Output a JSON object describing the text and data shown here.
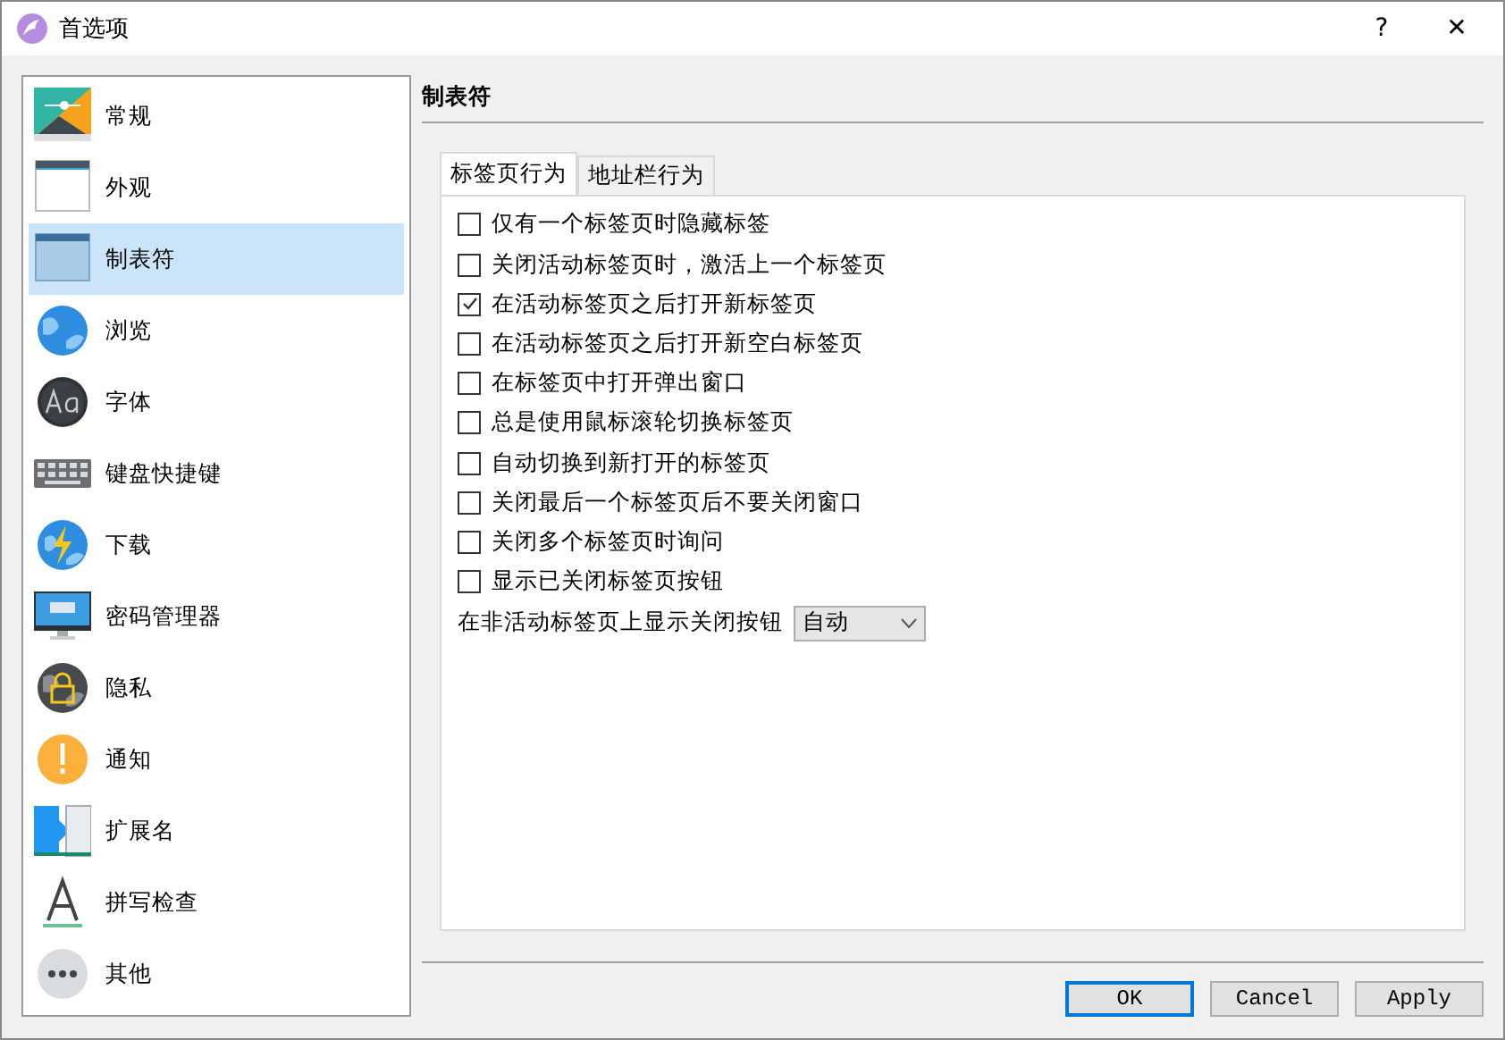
{
  "window": {
    "title": "首选项",
    "help": "?",
    "close": "✕"
  },
  "sidebar": {
    "items": [
      {
        "label": "常规",
        "selected": false
      },
      {
        "label": "外观",
        "selected": false
      },
      {
        "label": "制表符",
        "selected": true
      },
      {
        "label": "浏览",
        "selected": false
      },
      {
        "label": "字体",
        "selected": false
      },
      {
        "label": "键盘快捷键",
        "selected": false
      },
      {
        "label": "下载",
        "selected": false
      },
      {
        "label": "密码管理器",
        "selected": false
      },
      {
        "label": "隐私",
        "selected": false
      },
      {
        "label": "通知",
        "selected": false
      },
      {
        "label": "扩展名",
        "selected": false
      },
      {
        "label": "拼写检查",
        "selected": false
      },
      {
        "label": "其他",
        "selected": false
      }
    ]
  },
  "section_title": "制表符",
  "tabs": [
    {
      "label": "标签页行为",
      "selected": true
    },
    {
      "label": "地址栏行为",
      "selected": false
    }
  ],
  "options": [
    {
      "label": "仅有一个标签页时隐藏标签",
      "checked": false
    },
    {
      "label": "关闭活动标签页时，激活上一个标签页",
      "checked": false
    },
    {
      "label": "在活动标签页之后打开新标签页",
      "checked": true
    },
    {
      "label": "在活动标签页之后打开新空白标签页",
      "checked": false
    },
    {
      "label": "在标签页中打开弹出窗口",
      "checked": false
    },
    {
      "label": "总是使用鼠标滚轮切换标签页",
      "checked": false
    },
    {
      "label": "自动切换到新打开的标签页",
      "checked": false
    },
    {
      "label": "关闭最后一个标签页后不要关闭窗口",
      "checked": false
    },
    {
      "label": "关闭多个标签页时询问",
      "checked": false
    },
    {
      "label": "显示已关闭标签页按钮",
      "checked": false
    }
  ],
  "close_button_setting": {
    "label": "在非活动标签页上显示关闭按钮",
    "value": "自动"
  },
  "buttons": [
    {
      "label": "OK",
      "default": true
    },
    {
      "label": "Cancel",
      "default": false
    },
    {
      "label": "Apply",
      "default": false
    }
  ]
}
